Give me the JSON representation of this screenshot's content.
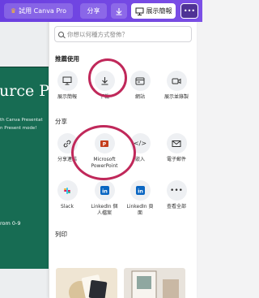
{
  "topbar": {
    "pro_label": "試用 Canva Pro",
    "share_label": "分享",
    "present_label": "展示簡報",
    "more_glyph": "•••"
  },
  "slide": {
    "title": "urce Po",
    "subtitle_line1": "th Canva Presentat",
    "subtitle_line2": "n Present mode!",
    "bottom_text": "rom 0-9"
  },
  "panel": {
    "search": {
      "placeholder": "你想以何種方式發佈？"
    },
    "sections": {
      "recommended": "推薦使用",
      "share": "分享",
      "print": "列印"
    },
    "recommended_items": [
      {
        "label": "展示簡報",
        "icon": "present-icon"
      },
      {
        "label": "下載",
        "icon": "download-icon"
      },
      {
        "label": "網站",
        "icon": "website-icon"
      },
      {
        "label": "展示並錄製",
        "icon": "record-icon"
      }
    ],
    "share_row1": [
      {
        "label": "分享連結",
        "icon": "link-icon"
      },
      {
        "label": "Microsoft PowerPoint",
        "icon": "powerpoint-icon"
      },
      {
        "label": "嵌入",
        "icon": "embed-icon"
      },
      {
        "label": "電子郵件",
        "icon": "email-icon"
      }
    ],
    "share_row2": [
      {
        "label": "Slack",
        "icon": "slack-icon"
      },
      {
        "label": "LinkedIn 個人檔案",
        "icon": "linkedin-icon"
      },
      {
        "label": "LinkedIn 頁面",
        "icon": "linkedin-icon"
      },
      {
        "label": "查看全部",
        "icon": "more-icon"
      }
    ]
  },
  "colors": {
    "topbar": "#6a3fe0",
    "slide": "#176c53",
    "highlight": "#c0285a"
  }
}
